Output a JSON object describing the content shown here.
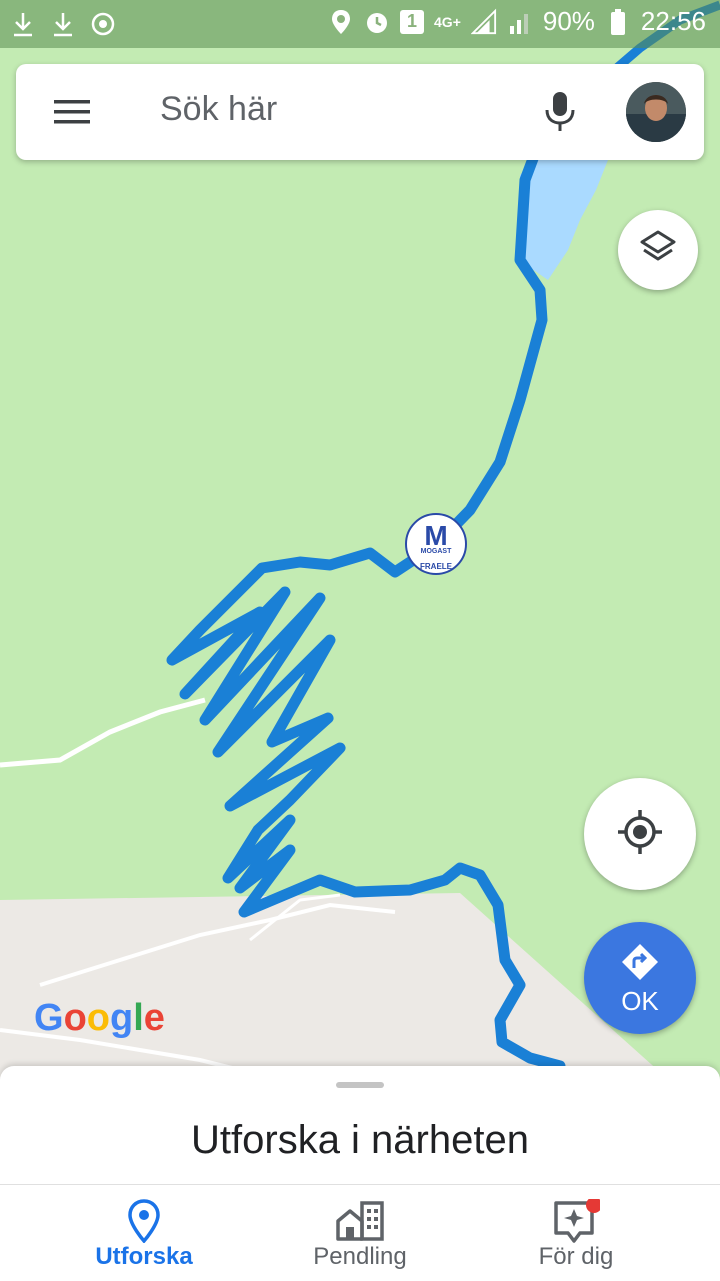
{
  "status_bar": {
    "battery": "90%",
    "time": "22:56",
    "sim_badge": "1",
    "network": "4G+"
  },
  "search": {
    "placeholder": "Sök här"
  },
  "map": {
    "poi_logo_text": "MOGAST",
    "poi_logo_subtext": "FRAELE",
    "poi_logo_initial": "M",
    "attribution": "Google"
  },
  "fab": {
    "directions_label": "OK"
  },
  "sheet": {
    "title": "Utforska i närheten"
  },
  "nav": [
    {
      "label": "Utforska",
      "icon": "pin-icon",
      "active": true
    },
    {
      "label": "Pendling",
      "icon": "commute-icon",
      "active": false
    },
    {
      "label": "För dig",
      "icon": "for-you-icon",
      "active": false
    }
  ],
  "colors": {
    "route": "#1a80d6",
    "map_green": "#c3ebb3",
    "water": "#aadaff",
    "accent": "#1a73e8",
    "directions_button": "#3b77e0"
  }
}
